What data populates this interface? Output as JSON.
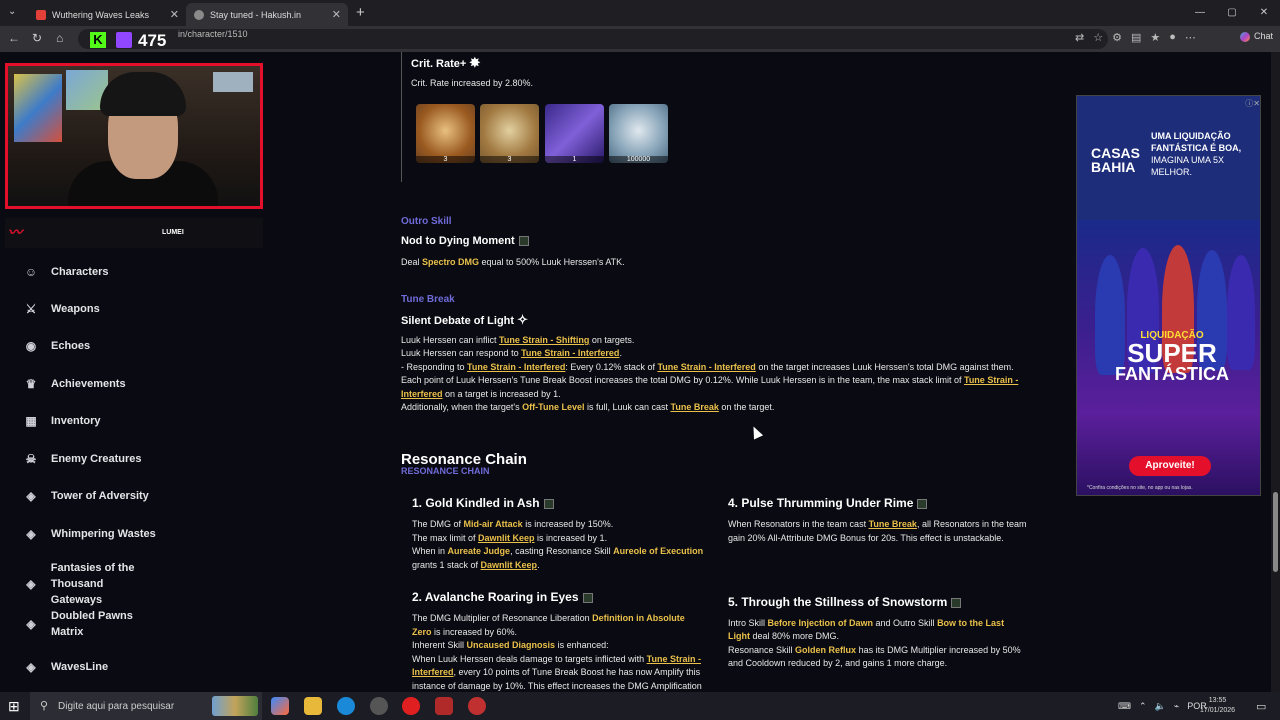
{
  "browser": {
    "tabs": [
      {
        "title": "Wuthering Waves Leaks",
        "icon": "bookmark-icon"
      },
      {
        "title": "Stay tuned - Hakush.in",
        "icon": "globe-icon"
      }
    ],
    "url": "in/character/1510",
    "chat_label": "Chat"
  },
  "stream": {
    "viewer_count": "475",
    "brand_label": "LUMEI"
  },
  "sidebar": {
    "items": [
      {
        "label": "Characters",
        "icon": "user-icon"
      },
      {
        "label": "Weapons",
        "icon": "sword-icon"
      },
      {
        "label": "Echoes",
        "icon": "echo-icon"
      },
      {
        "label": "Achievements",
        "icon": "trophy-icon"
      },
      {
        "label": "Inventory",
        "icon": "inventory-icon"
      },
      {
        "label": "Enemy Creatures",
        "icon": "enemy-icon"
      },
      {
        "label": "Tower of Adversity",
        "icon": "tower-icon"
      },
      {
        "label": "Whimpering Wastes",
        "icon": "wastes-icon"
      },
      {
        "label": "Fantasies of the Thousand Gateways",
        "icon": "fantasies-icon"
      },
      {
        "label": "Doubled Pawns Matrix",
        "icon": "pawns-icon"
      },
      {
        "label": "WavesLine",
        "icon": "wavesline-icon"
      }
    ]
  },
  "content": {
    "crit": {
      "title": "Crit. Rate+",
      "desc": "Crit. Rate increased by 2.80%.",
      "materials": [
        {
          "count": "3",
          "color": "#c98f3a"
        },
        {
          "count": "3",
          "color": "#b58b4a"
        },
        {
          "count": "1",
          "color": "#6a4fb8"
        },
        {
          "count": "100000",
          "color": "#5a7d9a"
        }
      ]
    },
    "outro": {
      "section": "Outro Skill",
      "title": "Nod to Dying Moment",
      "desc_pre": "Deal ",
      "desc_kw": "Spectro DMG",
      "desc_post": " equal to 500% Luuk Herssen's ATK."
    },
    "tune": {
      "section": "Tune Break",
      "title": "Silent Debate of Light",
      "l1_pre": "Luuk Herssen can inflict ",
      "l1_kw": "Tune Strain - Shifting",
      "l1_post": " on targets.",
      "l2_pre": "Luuk Herssen can respond to ",
      "l2_kw": "Tune Strain - Interfered",
      "l2_post": ".",
      "l3_pre": "- Responding to ",
      "l3_kw": "Tune Strain - Interfered",
      "l3_mid": ": Every 0.12% stack of ",
      "l3_kw2": "Tune Strain - Interfered",
      "l3_post": " on the target increases Luuk Herssen's total DMG against them.",
      "l4_pre": "Each point of Luuk Herssen's Tune Break Boost increases the total DMG by 0.12%. While Luuk Herssen is in the team, the max stack limit of ",
      "l4_kw": "Tune Strain -",
      "l5_kw": "Interfered",
      "l5_post": " on a target is increased by 1.",
      "l6_pre": "Additionally, when the target's ",
      "l6_kw": "Off-Tune Level",
      "l6_mid": " is full, Luuk can cast ",
      "l6_kw2": "Tune Break",
      "l6_post": " on the target."
    },
    "resonance": {
      "title": "Resonance Chain",
      "subtitle": "RESONANCE CHAIN",
      "c1": {
        "title": "1. Gold Kindled in Ash",
        "a_pre": "The DMG of ",
        "a_kw": "Mid-air Attack",
        "a_post": " is increased by 150%.",
        "b_pre": "The max limit of ",
        "b_kw": "Dawnlit Keep",
        "b_post": " is increased by 1.",
        "c_pre": "When in ",
        "c_kw": "Aureate Judge",
        "c_mid": ", casting Resonance Skill ",
        "c_kw2": "Aureole of Execution",
        "d_pre": "grants 1 stack of ",
        "d_kw": "Dawnlit Keep",
        "d_post": "."
      },
      "c2": {
        "title": "2. Avalanche Roaring in Eyes",
        "a_pre": "The DMG Multiplier of Resonance Liberation ",
        "a_kw": "Definition in Absolute",
        "b_kw": "Zero",
        "b_post": " is increased by 60%.",
        "c_pre": "Inherent Skill ",
        "c_kw": "Uncaused Diagnosis",
        "c_post": " is enhanced:",
        "d_pre": "When Luuk Herssen deals damage to targets inflicted with ",
        "d_kw": "Tune Strain -",
        "e_kw": "Interfered",
        "e_post": ", every 10 points of Tune Break Boost he has now Amplify this",
        "f": "instance of damage by 10%. This effect increases the DMG Amplification"
      },
      "c4": {
        "title": "4. Pulse Thrumming Under Rime",
        "a_pre": "When Resonators in the team cast ",
        "a_kw": "Tune Break",
        "a_post": ", all Resonators in the team",
        "b": "gain 20% All-Attribute DMG Bonus for 20s. This effect is unstackable."
      },
      "c5": {
        "title": "5. Through the Stillness of Snowstorm",
        "a_pre": "Intro Skill ",
        "a_kw": "Before Injection of Dawn",
        "a_mid": " and Outro Skill ",
        "a_kw2": "Bow to the Last",
        "b_kw": "Light",
        "b_post": " deal 80% more DMG.",
        "c_pre": "Resonance Skill ",
        "c_kw": "Golden Reflux",
        "c_post": " has its DMG Multiplier increased by 50%",
        "d": "and Cooldown reduced by 2, and gains 1 more charge."
      }
    }
  },
  "ad": {
    "brand_line1": "CASAS",
    "brand_line2": "BAHIA",
    "headline": "UMA LIQUIDAÇÃO FANTÁSTICA É BOA,",
    "subline": "IMAGINA UMA 5X MELHOR.",
    "promo_small": "LIQUIDAÇÃO",
    "promo_big1": "SUPER",
    "promo_big2": "FANTÁSTICA",
    "cta": "Aproveite!",
    "footnote": "*Confira condições no site, no app ou nas lojas."
  },
  "taskbar": {
    "search_placeholder": "Digite aqui para pesquisar",
    "lang": "POR",
    "time": "13:55",
    "date": "17/01/2026"
  }
}
